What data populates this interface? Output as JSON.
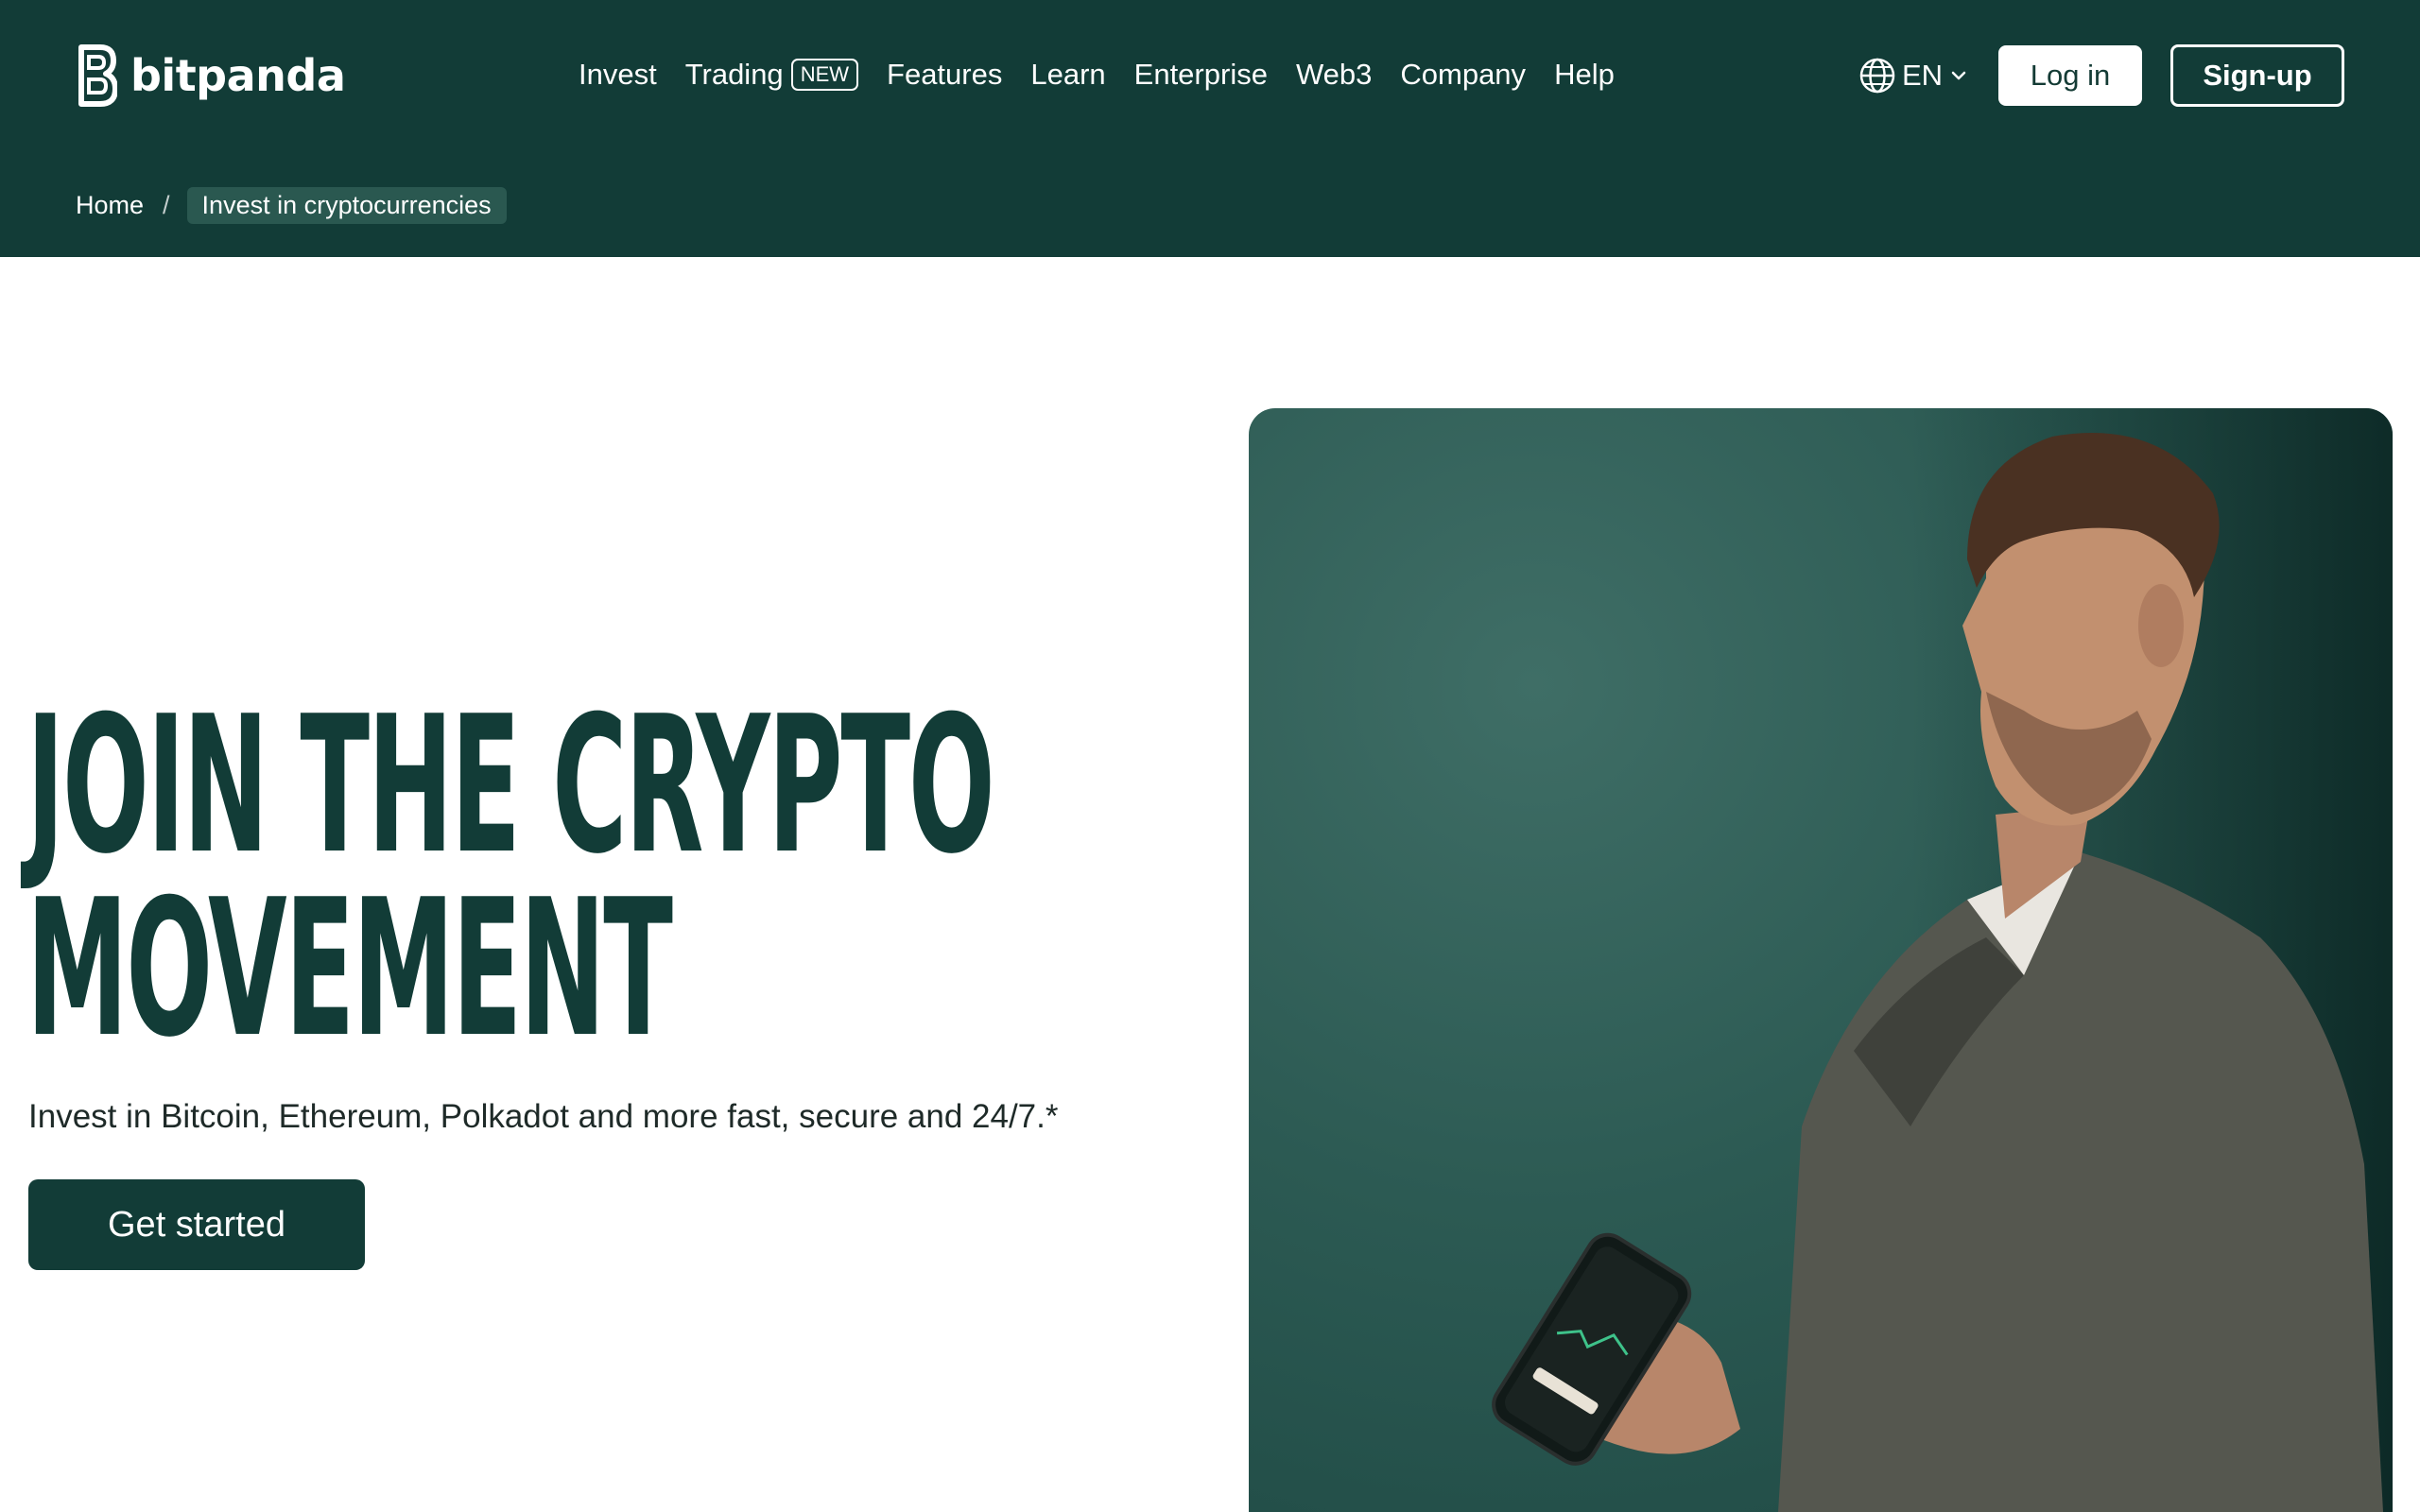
{
  "brand": {
    "name": "bitpanda",
    "color_primary": "#123c37",
    "color_light": "#ffffff"
  },
  "nav": {
    "items": [
      {
        "label": "Invest"
      },
      {
        "label": "Trading",
        "badge": "NEW"
      },
      {
        "label": "Features"
      },
      {
        "label": "Learn"
      },
      {
        "label": "Enterprise"
      },
      {
        "label": "Web3"
      },
      {
        "label": "Company"
      },
      {
        "label": "Help"
      }
    ]
  },
  "language": {
    "code": "EN",
    "icon": "globe-icon"
  },
  "auth": {
    "login_label": "Log in",
    "signup_label": "Sign-up"
  },
  "breadcrumb": {
    "home": "Home",
    "separator": "/",
    "current": "Invest in cryptocurrencies"
  },
  "hero": {
    "title_line1": "JOIN THE CRYPTO",
    "title_line2": "MOVEMENT",
    "subtitle": "Invest in Bitcoin, Ethereum, Polkadot and more fast, secure and 24/7.*",
    "cta_label": "Get started"
  }
}
